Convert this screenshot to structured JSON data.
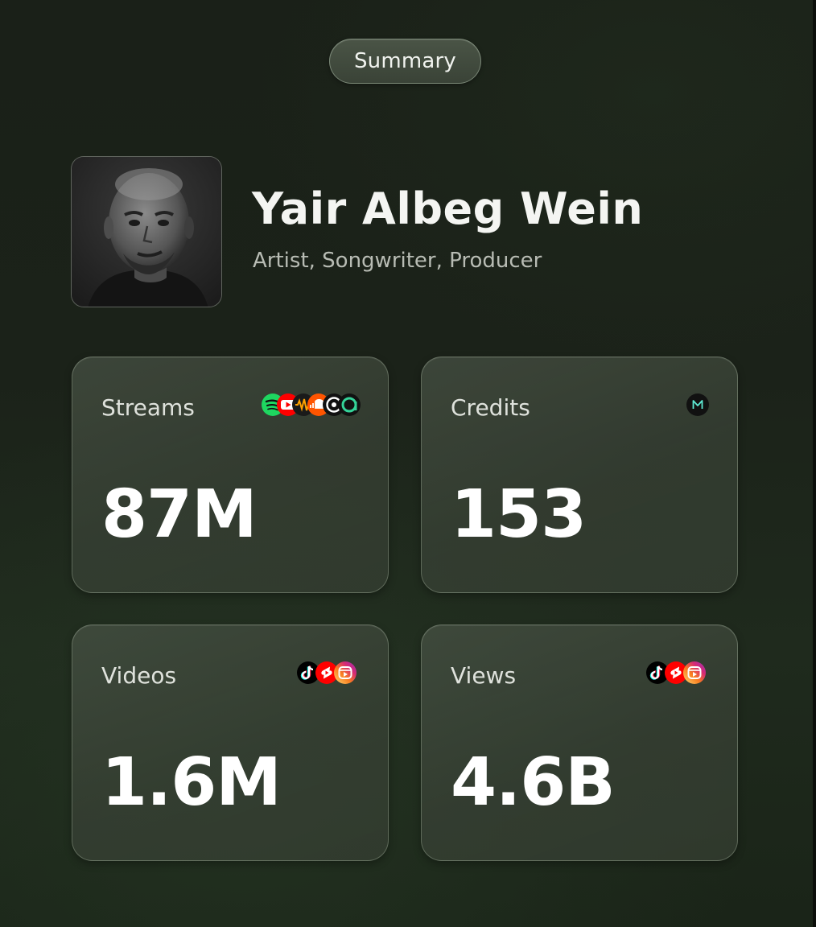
{
  "header": {
    "summary_label": "Summary"
  },
  "profile": {
    "name": "Yair Albeg Wein",
    "roles": "Artist, Songwriter, Producer",
    "avatar_icon": "artist-portrait"
  },
  "stats": [
    {
      "label": "Streams",
      "value": "87M",
      "platform_icons": [
        "spotify-icon",
        "youtube-icon",
        "audiomack-icon",
        "soundcloud-icon",
        "other-platform-icon",
        "anghami-icon"
      ]
    },
    {
      "label": "Credits",
      "value": "153",
      "platform_icons": [
        "credits-platform-icon"
      ]
    },
    {
      "label": "Videos",
      "value": "1.6M",
      "platform_icons": [
        "tiktok-icon",
        "youtube-shorts-icon",
        "instagram-reels-icon"
      ]
    },
    {
      "label": "Views",
      "value": "4.6B",
      "platform_icons": [
        "tiktok-icon",
        "youtube-shorts-icon",
        "instagram-reels-icon"
      ]
    }
  ],
  "colors": {
    "background": "#1b2219",
    "card": "#3e4a3b",
    "spotify": "#1ed760",
    "youtube": "#ff0000",
    "soundcloud": "#ff5500",
    "tiktok": "#000000",
    "instagram": "#d62976"
  }
}
